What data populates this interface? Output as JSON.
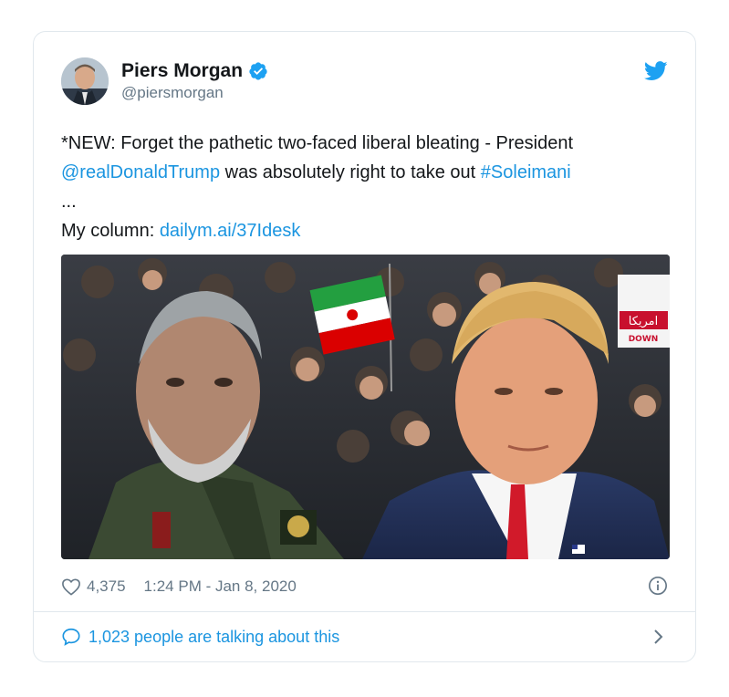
{
  "author": {
    "display_name": "Piers Morgan",
    "handle": "@piersmorgan",
    "verified": true
  },
  "tweet": {
    "line1": "*NEW: Forget the pathetic two-faced liberal bleating - President",
    "mention": "@realDonaldTrump",
    "line2_mid": " was absolutely right to take out ",
    "hashtag": "#Soleimani",
    "ellipsis": "...",
    "column_label": "My column: ",
    "column_link": "dailym.ai/37Idesk"
  },
  "media": {
    "sign_text": "امریکا",
    "sign_sub": "DOWN"
  },
  "stats": {
    "likes": "4,375",
    "timestamp": "1:24 PM - Jan 8, 2020"
  },
  "talking": {
    "label": "1,023 people are talking about this"
  },
  "colors": {
    "link": "#1b95e0",
    "muted": "#657786",
    "border": "#e1e8ed",
    "verified": "#1da1f2"
  },
  "icons": [
    "verified-badge-icon",
    "twitter-bird-icon",
    "heart-icon",
    "info-icon",
    "speech-bubble-icon",
    "chevron-right-icon"
  ]
}
